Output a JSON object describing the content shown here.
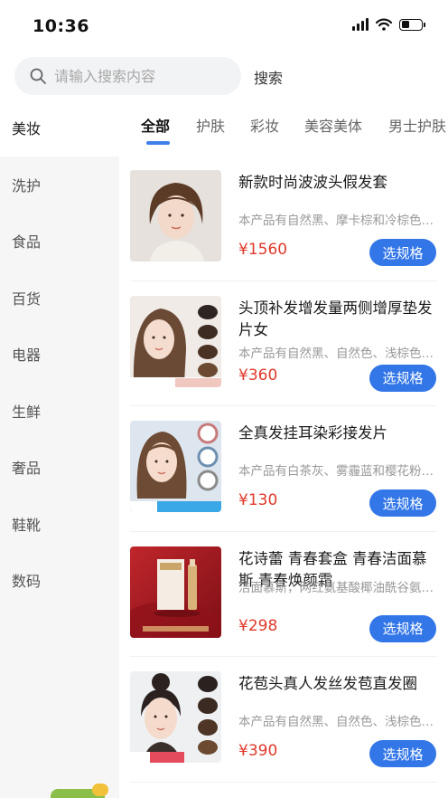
{
  "status_bar": {
    "time": "10:36"
  },
  "search": {
    "placeholder": "请输入搜索内容",
    "button_label": "搜索"
  },
  "sidebar": {
    "items": [
      {
        "label": "美妆"
      },
      {
        "label": "洗护"
      },
      {
        "label": "食品"
      },
      {
        "label": "百货"
      },
      {
        "label": "电器"
      },
      {
        "label": "生鲜"
      },
      {
        "label": "奢品"
      },
      {
        "label": "鞋靴"
      },
      {
        "label": "数码"
      }
    ]
  },
  "tabs": [
    {
      "label": "全部"
    },
    {
      "label": "护肤"
    },
    {
      "label": "彩妆"
    },
    {
      "label": "美容美体"
    },
    {
      "label": "男士护肤"
    }
  ],
  "products": [
    {
      "title": "新款时尚波波头假发套",
      "desc": "本产品有自然黑、摩卡棕和冷棕色可选",
      "price": "¥1560",
      "button": "选规格"
    },
    {
      "title": "头顶补发增发量两侧增厚垫发片女",
      "desc": "本产品有自然黑、自然色、浅棕色可选",
      "price": "¥360",
      "button": "选规格"
    },
    {
      "title": "全真发挂耳染彩接发片",
      "desc": "本产品有白茶灰、雾霾蓝和樱花粉可选",
      "price": "¥130",
      "button": "选规格"
    },
    {
      "title": "花诗蕾 青春套盒 青春洁面慕斯 青春焕颜霜",
      "desc": "洁面慕斯，网红氨基酸椰油酰谷氨酸钠",
      "price": "¥298",
      "button": "选规格"
    },
    {
      "title": "花苞头真人发丝发苞直发圈",
      "desc": "本产品有自然黑、自然色、浅棕色可选",
      "price": "¥390",
      "button": "选规格"
    }
  ],
  "colors": {
    "accent": "#3276e8",
    "price": "#e0392b"
  }
}
